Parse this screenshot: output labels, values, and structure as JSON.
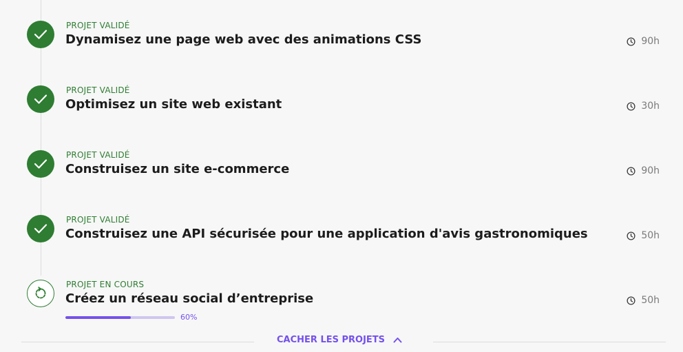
{
  "projects": [
    {
      "status": "PROJET VALIDÉ",
      "title": "Dynamisez une page web avec des animations CSS",
      "duration": "90h",
      "state": "done"
    },
    {
      "status": "PROJET VALIDÉ",
      "title": "Optimisez un site web existant",
      "duration": "30h",
      "state": "done"
    },
    {
      "status": "PROJET VALIDÉ",
      "title": "Construisez un site e-commerce",
      "duration": "90h",
      "state": "done"
    },
    {
      "status": "PROJET VALIDÉ",
      "title": "Construisez une API sécurisée pour une application d'avis gastronomiques",
      "duration": "50h",
      "state": "done"
    },
    {
      "status": "PROJET EN COURS",
      "title": "Créez un réseau social d’entreprise",
      "duration": "50h",
      "state": "in-progress",
      "progress": 0.6,
      "progress_label": "60%"
    }
  ],
  "footer": {
    "toggle_label": "CACHER LES PROJETS",
    "toggle_icon": "chevron-up-icon"
  },
  "icons": {
    "done": "check-icon",
    "in_progress": "refresh-icon",
    "duration": "clock-icon"
  },
  "colors": {
    "success": "#2e7d32",
    "accent": "#7451eb",
    "progress_track": "#cfc6f0",
    "text": "#1c1c1c",
    "muted": "#7a7a7a"
  }
}
